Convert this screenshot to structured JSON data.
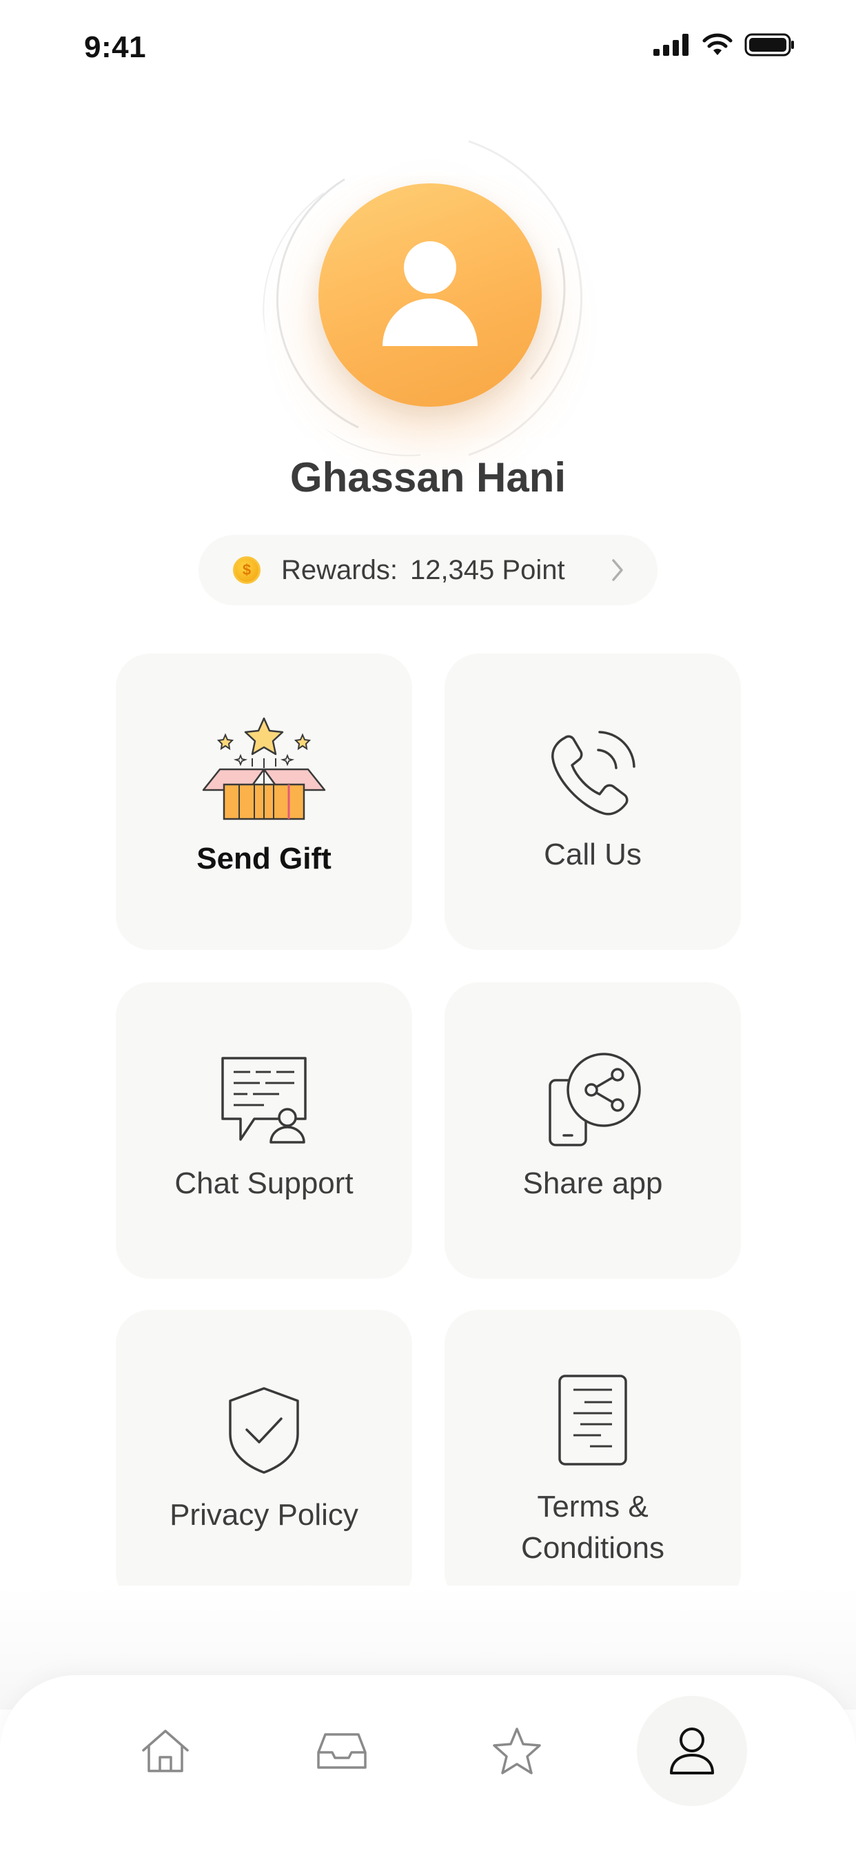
{
  "status_bar": {
    "time": "9:41"
  },
  "profile": {
    "name": "Ghassan Hani"
  },
  "rewards": {
    "label": "Rewards:",
    "value": "12,345 Point"
  },
  "menu": {
    "send_gift": "Send Gift",
    "call_us": "Call Us",
    "chat_support": "Chat Support",
    "share_app": "Share app",
    "privacy_policy": "Privacy Policy",
    "terms_line1": "Terms &",
    "terms_line2": "Conditions"
  },
  "colors": {
    "accent": "#fdb454",
    "card_bg": "#f8f8f6",
    "text": "#3d3d3d"
  },
  "bottom_nav": {
    "items": [
      "home-icon",
      "inbox-icon",
      "star-icon",
      "profile-icon"
    ],
    "active": "profile-icon"
  }
}
